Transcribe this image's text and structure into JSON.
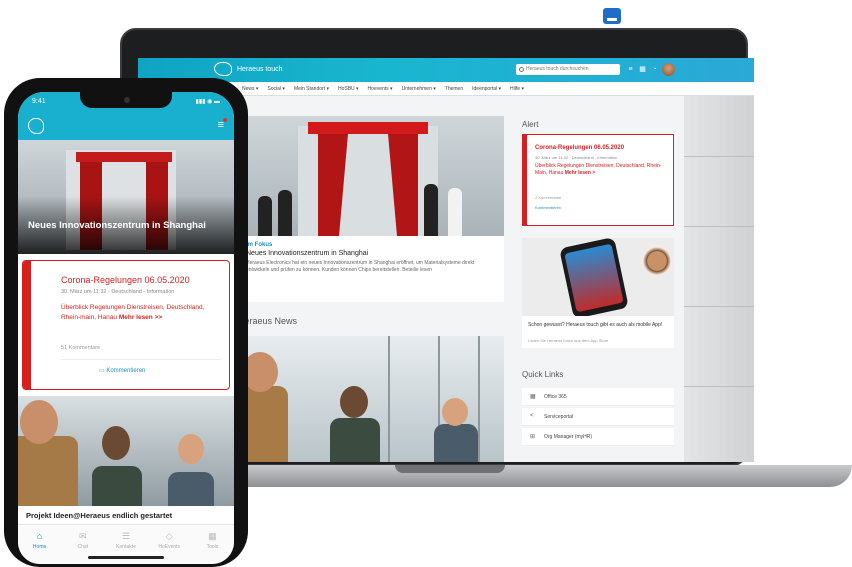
{
  "web": {
    "logo_text": "Heraeus touch",
    "search_placeholder": "Heraeus touch durchsuchen",
    "nav": [
      "News ▾",
      "Social ▾",
      "Mein Standort ▾",
      "HoSBU ▾",
      "Hoevents ▾",
      "Unternehmen ▾",
      "Themen",
      "Ideenportal ▾",
      "Hilfe ▾"
    ],
    "hero": {
      "kicker": "Im Fokus",
      "title": "Neues Innovationszentrum in Shanghai",
      "text": "Heraeus Electronics hat ein neues Innovationszentrum in Shanghai eröffnet, um Materialsysteme direkt entwickeln und prüfen zu können. Kunden können Chips bereitstellen. Beteilie lesen"
    },
    "news_heading": "Heraeus News",
    "alert": {
      "section_title": "Alert",
      "title": "Corona-Regelungen 06.05.2020",
      "meta": "30. März um 11:32 - Deutschland - Information",
      "text": "Überblick Regelungen Dienstreisen, Deutschland, Rhein-Main, Hanau",
      "more": "Mehr lesen >",
      "count": "2 Kommentare",
      "comment": "Kommentieren"
    },
    "promo": {
      "text": "Schon gewusst? Heraeus touch gibt es auch als mobile App!",
      "sub": "Laden Sie Heraeus touch aus dem App Store"
    },
    "quick_links": {
      "title": "Quick Links",
      "items": [
        "Office 365",
        "Serviceportal",
        "Org Manager (myHR)"
      ]
    }
  },
  "phone": {
    "time": "9:41",
    "status_icons": "▮▮▮ ◉ ▬",
    "hero_title": "Neues Innovationszentrum in Shanghai",
    "alert": {
      "title": "Corona-Regelungen 06.05.2020",
      "meta": "30. März um 11:32 - Deutschland - Information",
      "text": "Überblick Regelungen Dienstreisen, Deutschland, Rhein-main, Hanau ",
      "more": "Mehr lesen >>",
      "count": "51 Kommentare",
      "comment": "Kommentieren"
    },
    "photo_title": "Projekt Ideen@Heraeus endlich gestartet",
    "tabs": [
      "Home",
      "Chat",
      "Kontakte",
      "HoEvents",
      "Tools"
    ],
    "tab_icons": [
      "⌂",
      "✉",
      "☰",
      "◇",
      "▦"
    ]
  },
  "colors": {
    "brand": "#19b0cf",
    "alert": "#d62020",
    "link": "#1c8fbf"
  }
}
